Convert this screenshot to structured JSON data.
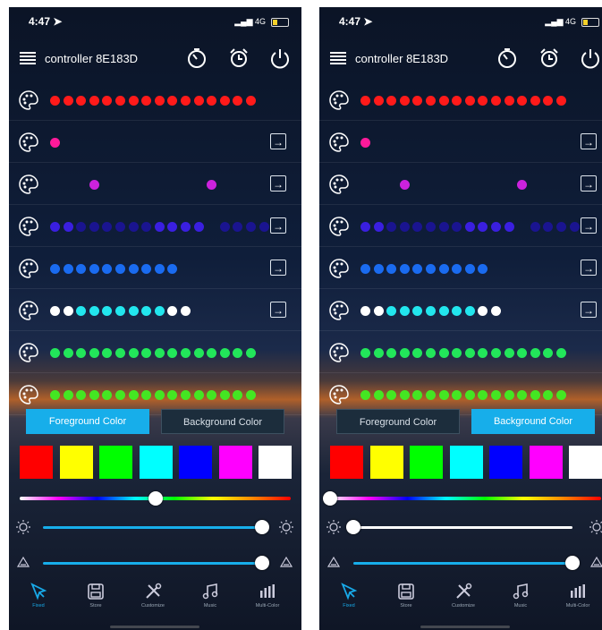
{
  "screens": [
    {
      "status": {
        "time": "4:47 ➤",
        "signal": "▂▄▆ 4G"
      },
      "header": {
        "title": "controller 8E183D"
      },
      "rows": [
        {
          "dots": [
            [
              "#ff1a1a",
              16
            ]
          ],
          "arrow": false
        },
        {
          "dots": [
            [
              "#ff1a9a",
              1
            ]
          ],
          "arrow": true
        },
        {
          "dots": [
            [
              "gap",
              3
            ],
            [
              "#cc22dd",
              1
            ],
            [
              "gap",
              8
            ],
            [
              "#cc22dd",
              1
            ]
          ],
          "arrow": true
        },
        {
          "dots": [
            [
              "#3a1fe0",
              2
            ],
            [
              "#1a1490",
              6
            ],
            [
              "#3a1fe0",
              4
            ],
            [
              "gap",
              1
            ],
            [
              "#1a1490",
              4
            ]
          ],
          "arrow": true
        },
        {
          "dots": [
            [
              "#1a6bf0",
              10
            ]
          ],
          "arrow": true
        },
        {
          "dots": [
            [
              "#ffffff",
              2
            ],
            [
              "#22e6ee",
              7
            ],
            [
              "#ffffff",
              2
            ]
          ],
          "arrow": true
        },
        {
          "dots": [
            [
              "#22e65a",
              16
            ]
          ],
          "arrow": false
        },
        {
          "dots": [
            [
              "#44e622",
              16
            ]
          ],
          "arrow": false
        }
      ],
      "tabs": {
        "foreground": "Foreground Color",
        "background": "Background Color",
        "active": "foreground"
      },
      "swatches": [
        "#ff0000",
        "#ffff00",
        "#00ff00",
        "#00ffff",
        "#0000ff",
        "#ff00ff",
        "#ffffff"
      ],
      "hue_position": 0.5,
      "brightness_value": 1.0,
      "brightness_color": "#17aeea",
      "speed_value": 1.0,
      "nav": [
        {
          "label": "Fixed",
          "icon": "pointer-icon",
          "active": true
        },
        {
          "label": "Store",
          "icon": "save-icon",
          "active": false
        },
        {
          "label": "Customize",
          "icon": "tools-icon",
          "active": false
        },
        {
          "label": "Music",
          "icon": "music-icon",
          "active": false
        },
        {
          "label": "Multi-Color",
          "icon": "bars-icon",
          "active": false
        }
      ]
    },
    {
      "status": {
        "time": "4:47 ➤",
        "signal": "▂▄▆ 4G"
      },
      "header": {
        "title": "controller 8E183D"
      },
      "rows": [
        {
          "dots": [
            [
              "#ff1a1a",
              16
            ]
          ],
          "arrow": false
        },
        {
          "dots": [
            [
              "#ff1a9a",
              1
            ]
          ],
          "arrow": true
        },
        {
          "dots": [
            [
              "gap",
              3
            ],
            [
              "#cc22dd",
              1
            ],
            [
              "gap",
              8
            ],
            [
              "#cc22dd",
              1
            ]
          ],
          "arrow": true
        },
        {
          "dots": [
            [
              "#3a1fe0",
              2
            ],
            [
              "#1a1490",
              6
            ],
            [
              "#3a1fe0",
              4
            ],
            [
              "gap",
              1
            ],
            [
              "#1a1490",
              4
            ]
          ],
          "arrow": true
        },
        {
          "dots": [
            [
              "#1a6bf0",
              10
            ]
          ],
          "arrow": true
        },
        {
          "dots": [
            [
              "#ffffff",
              2
            ],
            [
              "#22e6ee",
              7
            ],
            [
              "#ffffff",
              2
            ]
          ],
          "arrow": true
        },
        {
          "dots": [
            [
              "#22e65a",
              16
            ]
          ],
          "arrow": false
        },
        {
          "dots": [
            [
              "#44e622",
              16
            ]
          ],
          "arrow": false
        }
      ],
      "tabs": {
        "foreground": "Foreground Color",
        "background": "Background Color",
        "active": "background"
      },
      "swatches": [
        "#ff0000",
        "#ffff00",
        "#00ff00",
        "#00ffff",
        "#0000ff",
        "#ff00ff",
        "#ffffff"
      ],
      "hue_position": 0.0,
      "brightness_value": 0.0,
      "brightness_color": "#ffffff",
      "speed_value": 1.0,
      "nav": [
        {
          "label": "Fixed",
          "icon": "pointer-icon",
          "active": true
        },
        {
          "label": "Store",
          "icon": "save-icon",
          "active": false
        },
        {
          "label": "Customize",
          "icon": "tools-icon",
          "active": false
        },
        {
          "label": "Music",
          "icon": "music-icon",
          "active": false
        },
        {
          "label": "Multi-Color",
          "icon": "bars-icon",
          "active": false
        }
      ]
    }
  ]
}
